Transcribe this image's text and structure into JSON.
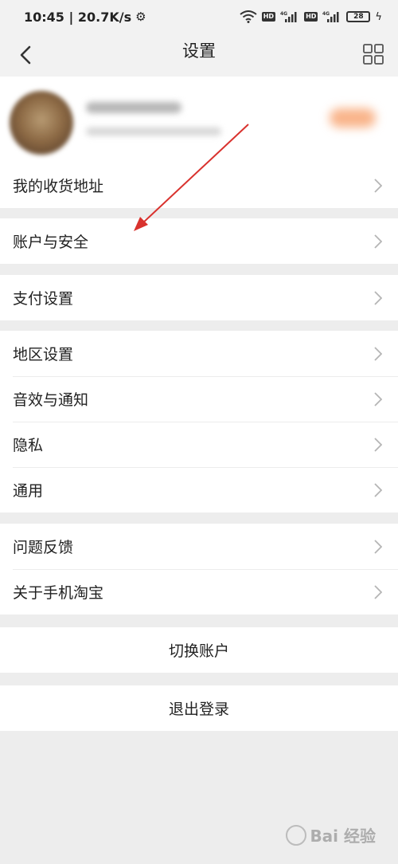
{
  "status_bar": {
    "time_speed": "10:45 | 20.7K/s",
    "net_label": "4G",
    "hd_label": "HD",
    "battery": "28"
  },
  "nav": {
    "title": "设置"
  },
  "groups": [
    {
      "items": [
        {
          "label": "我的收货地址"
        }
      ]
    },
    {
      "items": [
        {
          "label": "账户与安全"
        }
      ]
    },
    {
      "items": [
        {
          "label": "支付设置"
        }
      ]
    },
    {
      "items": [
        {
          "label": "地区设置"
        },
        {
          "label": "音效与通知"
        },
        {
          "label": "隐私"
        },
        {
          "label": "通用"
        }
      ]
    },
    {
      "items": [
        {
          "label": "问题反馈"
        },
        {
          "label": "关于手机淘宝"
        }
      ]
    }
  ],
  "actions": {
    "switch_account": "切换账户",
    "logout": "退出登录"
  },
  "watermark": "Bai 经验",
  "colors": {
    "background": "#ededed",
    "card": "#ffffff",
    "arrow": "#d9322e",
    "badge": "#f9b48a"
  }
}
